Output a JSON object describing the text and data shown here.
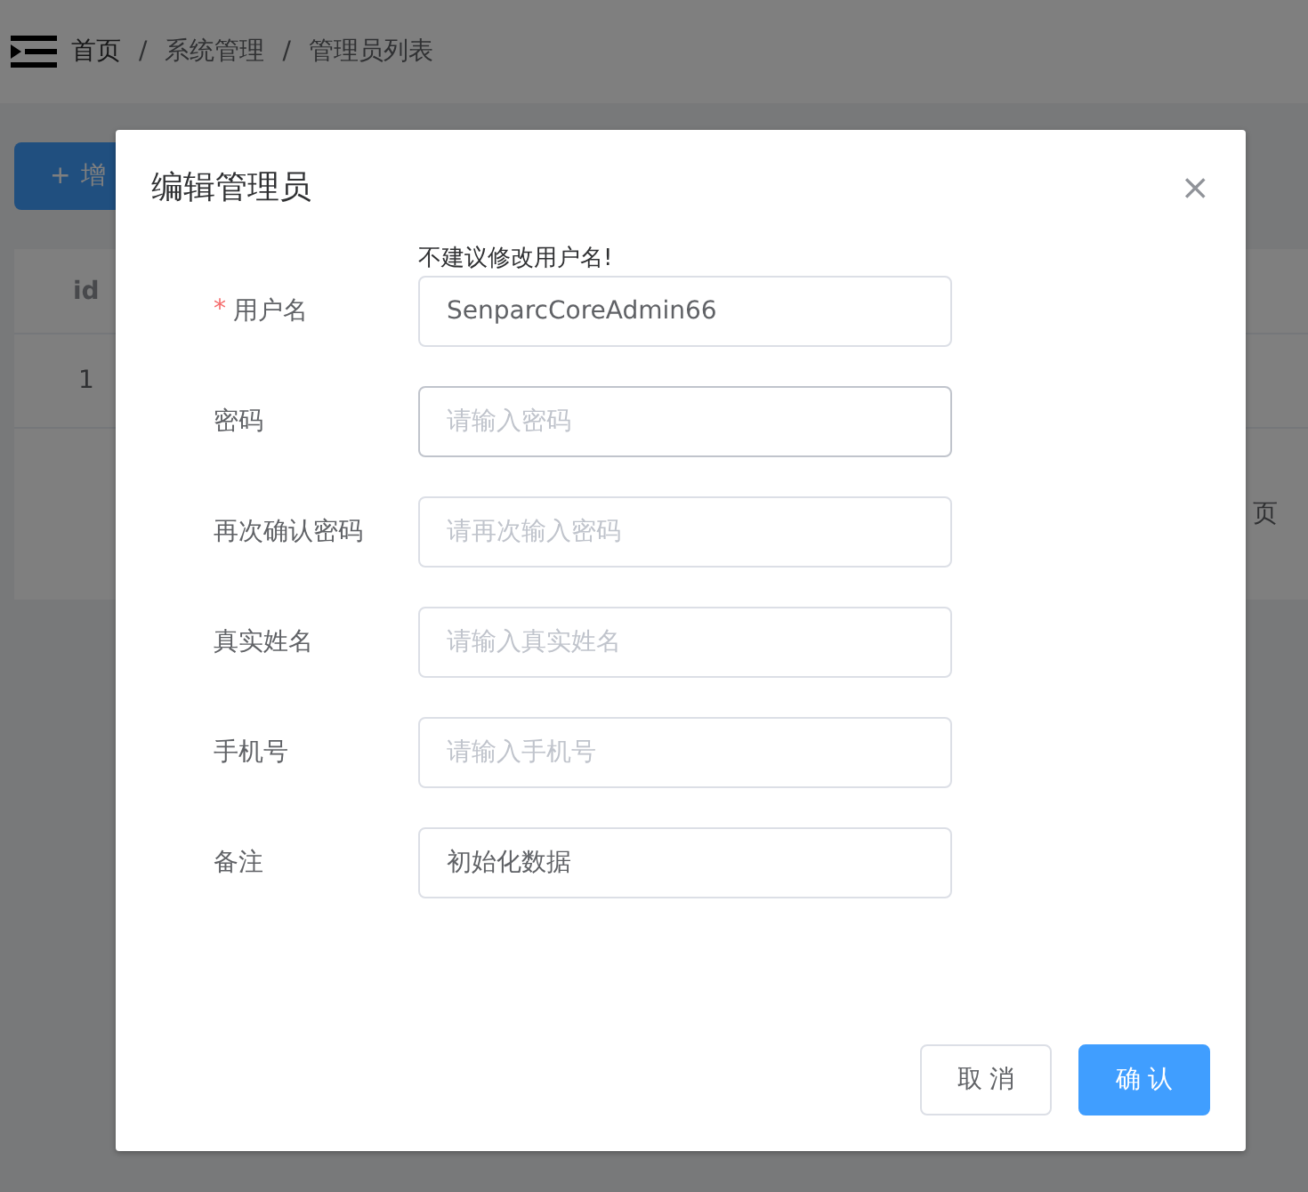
{
  "breadcrumb": [
    {
      "label": "首页",
      "current": false
    },
    {
      "label": "系统管理",
      "current": true
    },
    {
      "label": "管理员列表",
      "current": true
    }
  ],
  "breadcrumb_separator": "/",
  "required_mark": "*",
  "add_button": {
    "icon": "+",
    "label": "增"
  },
  "table": {
    "columns": [
      "id"
    ],
    "rows": [
      [
        "1"
      ]
    ]
  },
  "pagination": {
    "text": "页"
  },
  "dialog": {
    "title": "编辑管理员",
    "close": "×",
    "fields": [
      {
        "label": "用户名",
        "required": true,
        "hint": "不建议修改用户名!",
        "value": "SenparcCoreAdmin66",
        "focused": false
      },
      {
        "label": "密码",
        "required": false,
        "placeholder": "请输入密码",
        "focused": true
      },
      {
        "label": "再次确认密码",
        "required": false,
        "placeholder": "请再次输入密码",
        "focused": false
      },
      {
        "label": "真实姓名",
        "required": false,
        "placeholder": "请输入真实姓名",
        "focused": false
      },
      {
        "label": "手机号",
        "required": false,
        "placeholder": "请输入手机号",
        "focused": false
      },
      {
        "label": "备注",
        "required": false,
        "value": "初始化数据",
        "focused": false
      }
    ],
    "buttons": [
      {
        "label": "取 消",
        "kind": "default"
      },
      {
        "label": "确 认",
        "kind": "primary"
      }
    ]
  }
}
